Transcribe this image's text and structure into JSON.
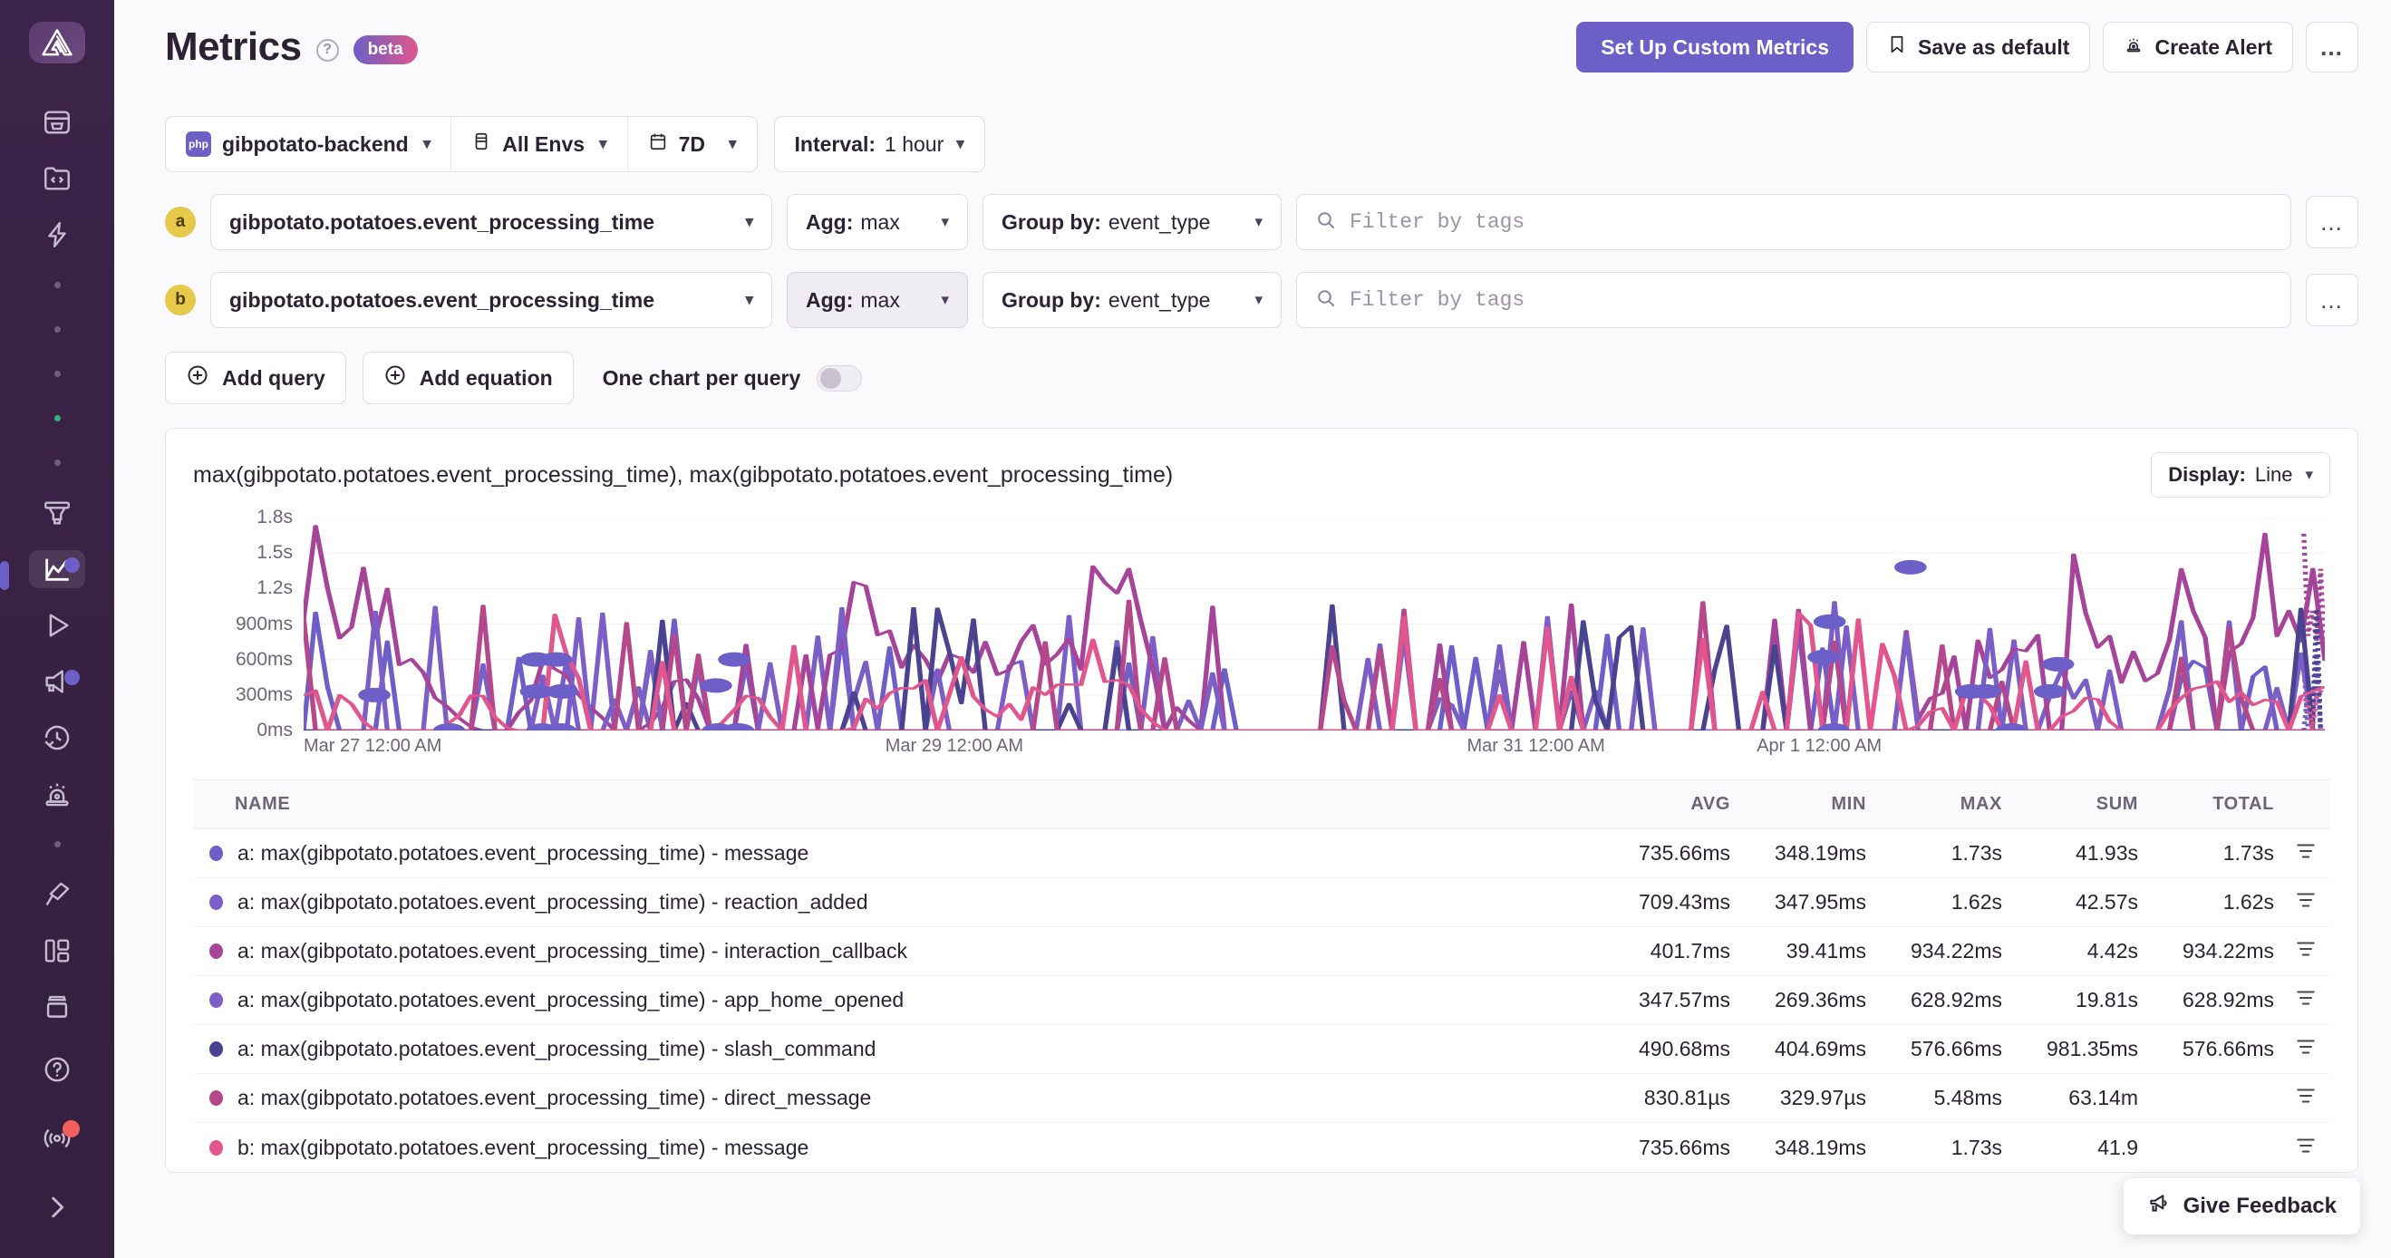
{
  "sidebar": {
    "logo_icon": "sentry-logo-icon",
    "items": [
      {
        "icon": "issues-inbox-icon",
        "name": "issues"
      },
      {
        "icon": "projects-code-folder-icon",
        "name": "projects"
      },
      {
        "icon": "performance-bolt-icon",
        "name": "performance"
      },
      {
        "icon": "releases-funnel-icon",
        "name": "releases"
      },
      {
        "icon": "metrics-line-chart-icon",
        "name": "metrics",
        "active": true,
        "badge": "new"
      },
      {
        "icon": "replays-play-icon",
        "name": "replays"
      },
      {
        "icon": "user-feedback-megaphone-icon",
        "name": "user-feedback",
        "badge": "new"
      },
      {
        "icon": "crons-clock-history-icon",
        "name": "crons"
      },
      {
        "icon": "alerts-siren-icon",
        "name": "alerts"
      },
      {
        "icon": "discover-telescope-icon",
        "name": "discover"
      },
      {
        "icon": "dashboards-layout-icon",
        "name": "dashboards"
      },
      {
        "icon": "profiling-stack-icon",
        "name": "profiling"
      },
      {
        "icon": "help-question-icon",
        "name": "help"
      },
      {
        "icon": "broadcast-signal-icon",
        "name": "whats-new",
        "badge": "alert"
      },
      {
        "icon": "expand-chevron-right-icon",
        "name": "expand-sidebar"
      }
    ]
  },
  "header": {
    "title": "Metrics",
    "help_icon": "question-mark-icon",
    "beta_badge": "beta",
    "actions": {
      "setup_custom_metrics": "Set Up Custom Metrics",
      "save_as_default": "Save as default",
      "save_icon": "bookmark-icon",
      "create_alert": "Create Alert",
      "alert_icon": "siren-icon",
      "more": "…"
    }
  },
  "filters": {
    "project": {
      "label": "gibpotato-backend",
      "platform_badge": "php"
    },
    "environment": {
      "label": "All Envs",
      "icon": "environment-box-icon"
    },
    "date_range": {
      "label": "7D",
      "icon": "calendar-icon"
    },
    "interval": {
      "label": "Interval:",
      "value": "1 hour"
    }
  },
  "queries": [
    {
      "letter": "a",
      "metric": "gibpotato.potatoes.event_processing_time",
      "agg_label": "Agg:",
      "agg_value": "max",
      "agg_selected": false,
      "group_label": "Group by:",
      "group_value": "event_type",
      "tag_filter_value": "",
      "tag_filter_placeholder": "Filter by tags",
      "search_icon": "search-icon",
      "more": "…"
    },
    {
      "letter": "b",
      "metric": "gibpotato.potatoes.event_processing_time",
      "agg_label": "Agg:",
      "agg_value": "max",
      "agg_selected": true,
      "group_label": "Group by:",
      "group_value": "event_type",
      "tag_filter_value": "",
      "tag_filter_placeholder": "Filter by tags",
      "search_icon": "search-icon",
      "more": "…"
    }
  ],
  "actions": {
    "add_query": "Add query",
    "add_equation": "Add equation",
    "plus_icon": "plus-circle-icon",
    "one_chart_per_query": "One chart per query",
    "one_chart_per_query_on": false
  },
  "chart_panel": {
    "title": "max(gibpotato.potatoes.event_processing_time), max(gibpotato.potatoes.event_processing_time)",
    "display_label": "Display:",
    "display_value": "Line"
  },
  "chart_data": {
    "type": "line",
    "title": "max(gibpotato.potatoes.event_processing_time), max(gibpotato.potatoes.event_processing_time)",
    "xlabel": "",
    "ylabel": "",
    "ylim": [
      0,
      1800
    ],
    "yunit": "ms",
    "grid": true,
    "legend": "table-below",
    "ytick_labels": [
      "1.8s",
      "1.5s",
      "1.2s",
      "900ms",
      "600ms",
      "300ms",
      "0ms"
    ],
    "ytick_values": [
      1800,
      1500,
      1200,
      900,
      600,
      300,
      0
    ],
    "xtick_labels": [
      "Mar 27 12:00 AM",
      "Mar 29 12:00 AM",
      "Mar 31 12:00 AM",
      "Apr 1 12:00 AM"
    ],
    "xtick_positions": [
      0.0,
      0.287,
      0.574,
      0.717
    ],
    "series": [
      {
        "name": "a: max(gibpotato.potatoes.event_processing_time) - message",
        "color": "#6c5fc7",
        "values": [
          0,
          0,
          0,
          0,
          0,
          0,
          0,
          0,
          0,
          0,
          0,
          0,
          0,
          0,
          0,
          0,
          0,
          0,
          0,
          0,
          0,
          0,
          0,
          0,
          0,
          0,
          0,
          0,
          0,
          0,
          0,
          0,
          0,
          0,
          0,
          0,
          0,
          0,
          0,
          0,
          0,
          0,
          0,
          0,
          0,
          0,
          0,
          0,
          0,
          0,
          0,
          0,
          0,
          0,
          0,
          0,
          0,
          0,
          0,
          0
        ]
      },
      {
        "name": "a: max(gibpotato.potatoes.event_processing_time) - reaction_added",
        "color": "#7b5fc7",
        "values": [
          0,
          0,
          0,
          0,
          0,
          0,
          0,
          0,
          0,
          0,
          0,
          0,
          0,
          0,
          0,
          0,
          0,
          0,
          0,
          0,
          0,
          0,
          0,
          0,
          0,
          0,
          0,
          0,
          0,
          0,
          0,
          0,
          0,
          0,
          0,
          0,
          0,
          0,
          0,
          0,
          0,
          0,
          0,
          0,
          0,
          0,
          0,
          0,
          0,
          0,
          0,
          0,
          0,
          0,
          0,
          0,
          0,
          0,
          0,
          0
        ]
      },
      {
        "name": "a: max(gibpotato.potatoes.event_processing_time) - interaction_callback",
        "color": "#a6449a",
        "values": [
          1450,
          900,
          640,
          590,
          300,
          0,
          0,
          560,
          480,
          0,
          0,
          600,
          0,
          0,
          0,
          0,
          1520,
          700,
          620,
          680,
          700,
          860,
          690,
          700,
          1490,
          600,
          0,
          0,
          0,
          0,
          0,
          0,
          0,
          0,
          0,
          0,
          0,
          0,
          0,
          0,
          0,
          0,
          0,
          0,
          0,
          0,
          0,
          0,
          600,
          620,
          600,
          1700,
          980,
          620,
          640,
          1400,
          900,
          880,
          870,
          620
        ]
      },
      {
        "name": "a: max(gibpotato.potatoes.event_processing_time) - app_home_opened",
        "color": "#7b5fc7",
        "values": [
          0,
          0,
          0,
          0,
          0,
          0,
          0,
          0,
          0,
          0,
          0,
          0,
          0,
          0,
          0,
          0,
          0,
          0,
          0,
          0,
          0,
          0,
          0,
          0,
          0,
          0,
          0,
          0,
          0,
          0,
          0,
          0,
          0,
          0,
          0,
          0,
          0,
          0,
          0,
          0,
          0,
          0,
          0,
          0,
          0,
          0,
          0,
          0,
          0,
          0,
          0,
          0,
          0,
          0,
          0,
          0,
          0,
          0,
          0,
          0
        ]
      },
      {
        "name": "a: max(gibpotato.potatoes.event_processing_time) - slash_command",
        "color": "#4a4390",
        "values": [
          0,
          0,
          0,
          0,
          0,
          0,
          0,
          0,
          0,
          0,
          0,
          0,
          0,
          0,
          0,
          0,
          0,
          0,
          0,
          0,
          0,
          0,
          0,
          0,
          0,
          0,
          0,
          0,
          0,
          0,
          0,
          0,
          0,
          0,
          0,
          0,
          0,
          0,
          0,
          0,
          0,
          0,
          0,
          0,
          0,
          0,
          0,
          0,
          0,
          0,
          0,
          0,
          0,
          0,
          0,
          0,
          0,
          0,
          0,
          0
        ]
      },
      {
        "name": "a: max(gibpotato.potatoes.event_processing_time) - direct_message",
        "color": "#b5478b",
        "values": [
          0,
          0,
          0,
          0,
          0,
          0,
          0,
          0,
          0,
          0,
          0,
          0,
          0,
          0,
          0,
          0,
          0,
          0,
          0,
          0,
          0,
          0,
          0,
          0,
          0,
          0,
          0,
          0,
          0,
          0,
          0,
          0,
          0,
          0,
          0,
          0,
          0,
          0,
          0,
          0,
          0,
          0,
          0,
          0,
          0,
          0,
          0,
          0,
          0,
          0,
          0,
          0,
          0,
          0,
          0,
          0,
          0,
          0,
          0,
          0
        ]
      },
      {
        "name": "b: max(gibpotato.potatoes.event_processing_time) - message",
        "color": "#e1568c",
        "values": [
          300,
          330,
          0,
          0,
          0,
          320,
          0,
          0,
          0,
          0,
          0,
          0,
          0,
          320,
          0,
          0,
          0,
          350,
          370,
          370,
          130,
          110,
          370,
          400,
          400,
          0,
          0,
          0,
          0,
          0,
          0,
          0,
          0,
          0,
          0,
          0,
          0,
          0,
          0,
          0,
          0,
          0,
          0,
          0,
          0,
          0,
          0,
          0,
          300,
          320,
          0,
          0,
          340,
          0,
          0,
          330,
          340,
          320,
          330,
          300
        ]
      }
    ]
  },
  "table": {
    "columns": [
      "NAME",
      "AVG",
      "MIN",
      "MAX",
      "SUM",
      "TOTAL"
    ],
    "rows": [
      {
        "color": "#6c5fc7",
        "name": "a: max(gibpotato.potatoes.event_processing_time) - message",
        "avg": "735.66ms",
        "min": "348.19ms",
        "max": "1.73s",
        "sum": "41.93s",
        "total": "1.73s"
      },
      {
        "color": "#7b5fc7",
        "name": "a: max(gibpotato.potatoes.event_processing_time) - reaction_added",
        "avg": "709.43ms",
        "min": "347.95ms",
        "max": "1.62s",
        "sum": "42.57s",
        "total": "1.62s"
      },
      {
        "color": "#a6449a",
        "name": "a: max(gibpotato.potatoes.event_processing_time) - interaction_callback",
        "avg": "401.7ms",
        "min": "39.41ms",
        "max": "934.22ms",
        "sum": "4.42s",
        "total": "934.22ms"
      },
      {
        "color": "#7b5fc7",
        "name": "a: max(gibpotato.potatoes.event_processing_time) - app_home_opened",
        "avg": "347.57ms",
        "min": "269.36ms",
        "max": "628.92ms",
        "sum": "19.81s",
        "total": "628.92ms"
      },
      {
        "color": "#4a4390",
        "name": "a: max(gibpotato.potatoes.event_processing_time) - slash_command",
        "avg": "490.68ms",
        "min": "404.69ms",
        "max": "576.66ms",
        "sum": "981.35ms",
        "total": "576.66ms"
      },
      {
        "color": "#b5478b",
        "name": "a: max(gibpotato.potatoes.event_processing_time) - direct_message",
        "avg": "830.81µs",
        "min": "329.97µs",
        "max": "5.48ms",
        "sum": "63.14m",
        "total": ""
      },
      {
        "color": "#e1568c",
        "name": "b: max(gibpotato.potatoes.event_processing_time) - message",
        "avg": "735.66ms",
        "min": "348.19ms",
        "max": "1.73s",
        "sum": "41.9",
        "total": ""
      }
    ]
  },
  "feedback": {
    "label": "Give Feedback",
    "icon": "megaphone-icon"
  }
}
